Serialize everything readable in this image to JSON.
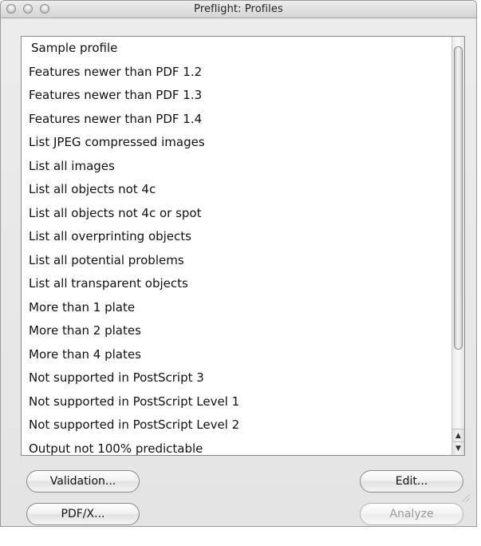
{
  "window": {
    "title": "Preflight: Profiles"
  },
  "profiles": {
    "items": [
      "Sample profile",
      "Features newer than PDF 1.2",
      "Features newer than PDF 1.3",
      "Features newer than PDF 1.4",
      "List JPEG compressed images",
      "List all images",
      "List all objects not 4c",
      "List all objects not 4c or spot",
      "List all overprinting objects",
      "List all potential problems",
      "List all transparent objects",
      "More than 1 plate",
      "More than 2 plates",
      "More than 4 plates",
      "Not supported in PostScript 3",
      "Not supported in PostScript Level 1",
      "Not supported in PostScript Level 2",
      "Output not 100% predictable"
    ]
  },
  "scrollbar": {
    "up_arrow_glyph": "▲",
    "down_arrow_glyph": "▼"
  },
  "buttons": {
    "validation": "Validation...",
    "pdfx": "PDF/X...",
    "edit": "Edit...",
    "analyze": "Analyze"
  },
  "colors": {
    "window_bg": "#e8e8e8",
    "list_bg": "#ffffff",
    "disabled_text": "#9a9a9a"
  }
}
